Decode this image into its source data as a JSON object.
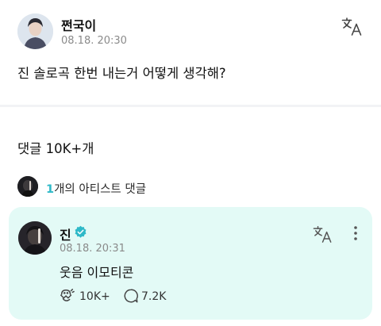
{
  "post": {
    "author": "쩐국이",
    "time": "08.18. 20:30",
    "text": "진 솔로곡 한번 내는거 어떻게 생각해?",
    "translate_icon": "translate-icon"
  },
  "comments": {
    "header": "댓글 10K+개",
    "artist_count": "1",
    "artist_label": "개의 아티스트 댓글"
  },
  "artist_comment": {
    "author": "진",
    "verified_icon": "verified-badge-icon",
    "time": "08.18. 20:31",
    "text": "웃음 이모티콘",
    "like_count": "10K+",
    "reply_count": "7.2K"
  },
  "colors": {
    "accent": "#2fb9c8",
    "card_background": "#e3faf6",
    "muted_text": "#8a8a8a"
  }
}
